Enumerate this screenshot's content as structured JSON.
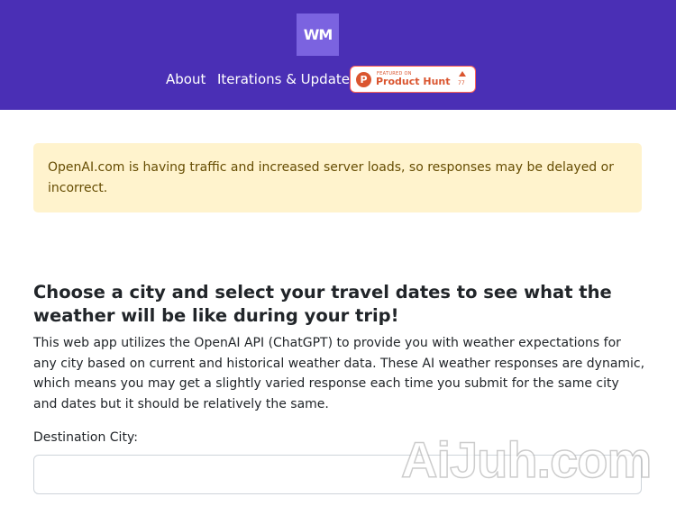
{
  "header": {
    "logo_text": "WM",
    "nav": [
      {
        "label": "About"
      },
      {
        "label": "Iterations & Updates"
      }
    ],
    "product_hunt": {
      "featured": "FEATURED ON",
      "name": "Product Hunt",
      "count": "77",
      "brand_color": "#da552f"
    },
    "background_color": "#4a2fb5"
  },
  "alert": {
    "text": "OpenAI.com is having traffic and increased server loads, so responses may be delayed or incorrect.",
    "background_color": "#fff3cd"
  },
  "main": {
    "heading": "Choose a city and select your travel dates to see what the weather will be like during your trip!",
    "intro": "This web app utilizes the OpenAI API (ChatGPT) to provide you with weather expectations for any city based on current and historical weather data. These AI weather responses are dynamic, which means you may get a slightly varied response each time you submit for the same city and dates but it should be relatively the same.",
    "city_label": "Destination City:",
    "city_value": "",
    "city_placeholder": ""
  },
  "watermark": {
    "text": "AiJuh.com"
  }
}
